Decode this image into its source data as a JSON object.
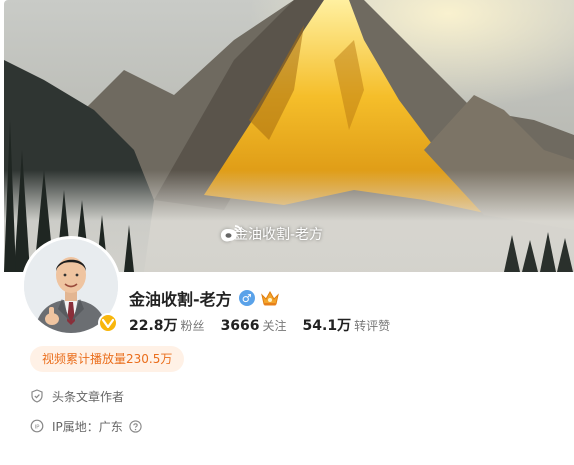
{
  "cover": {
    "watermark_text": "@金油收割-老方",
    "watermark_icon": "weibo-logo-icon"
  },
  "profile": {
    "name": "金油收割-老方",
    "gender_symbol": "♂",
    "gender_icon": "male-icon",
    "badge_icon": "crown-badge-icon",
    "verified_icon": "verified-v-icon",
    "verified_color": "#f8b60c"
  },
  "stats": {
    "followers_value": "22.8万",
    "followers_label": "粉丝",
    "following_value": "3666",
    "following_label": "关注",
    "likes_value": "54.1万",
    "likes_label": "转评赞"
  },
  "video_play_tag": "视频累计播放量230.5万",
  "info": {
    "role": "头条文章作者",
    "role_icon": "shield-check-icon",
    "ip_location": "IP属地：广东",
    "ip_icon": "ip-pin-icon",
    "help_icon": "question-circle-icon"
  },
  "colors": {
    "accent_orange": "#ea6e1c",
    "tag_bg": "#fff1e6",
    "gender_blue": "#5aa2e9"
  }
}
